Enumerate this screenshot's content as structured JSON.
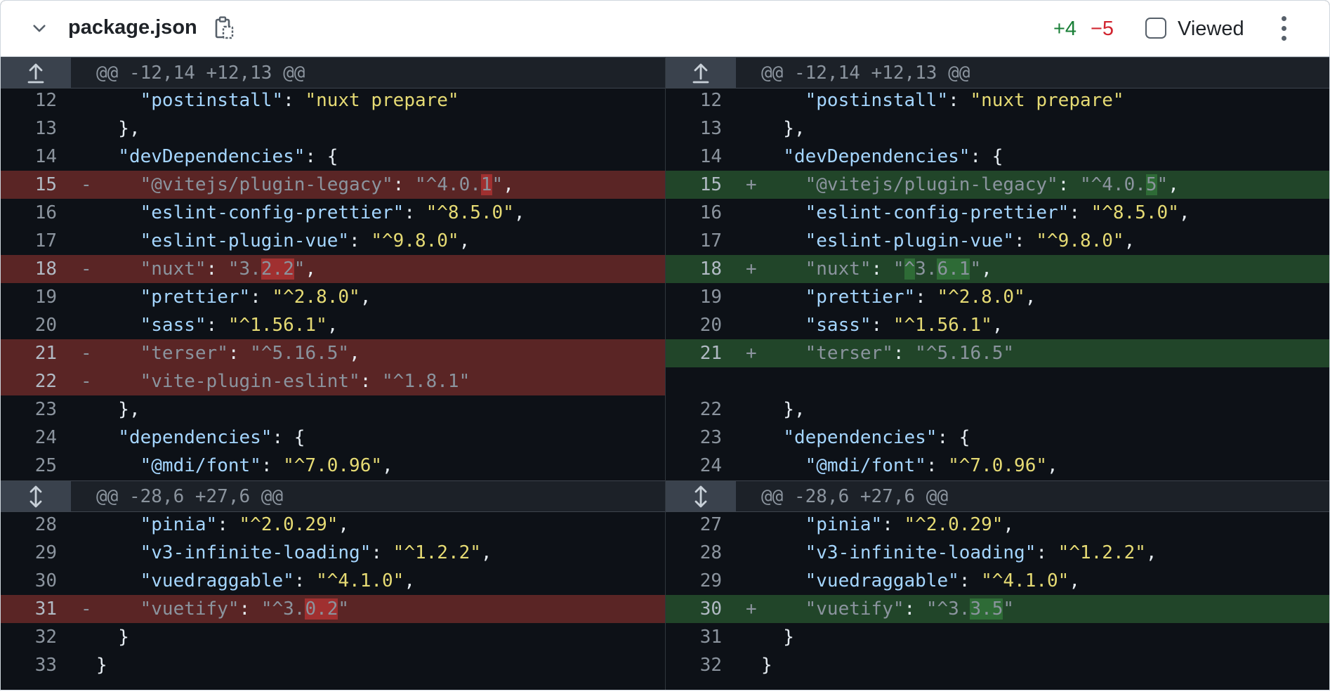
{
  "header": {
    "filename": "package.json",
    "additions": "+4",
    "deletions": "−5",
    "viewed_label": "Viewed",
    "icons": {
      "collapse": "chevron-down-icon",
      "copy": "copy-path-icon",
      "more": "kebab-menu-icon"
    }
  },
  "hunks": [
    {
      "left": "@@ -12,14 +12,13 @@",
      "right": "@@ -12,14 +12,13 @@",
      "icon": "expand-up-icon"
    },
    {
      "left": "@@ -28,6 +27,6 @@",
      "right": "@@ -28,6 +27,6 @@",
      "icon": "expand-both-icon"
    }
  ],
  "left_lines": [
    {
      "n": "12",
      "t": "ctx",
      "a": "    ",
      "k": "\"postinstall\"",
      "b": ": ",
      "v": "\"nuxt prepare\"",
      "c": ""
    },
    {
      "n": "13",
      "t": "ctx",
      "a": "  },",
      "k": "",
      "b": "",
      "v": "",
      "c": ""
    },
    {
      "n": "14",
      "t": "ctx",
      "a": "  ",
      "k": "\"devDependencies\"",
      "b": ": {",
      "v": "",
      "c": ""
    },
    {
      "n": "15",
      "t": "del",
      "a": "    ",
      "k": "\"@vitejs/plugin-legacy\"",
      "b": ": ",
      "v": "\"^4.0.",
      "h": "1",
      "v2": "\"",
      "c": ","
    },
    {
      "n": "16",
      "t": "ctx",
      "a": "    ",
      "k": "\"eslint-config-prettier\"",
      "b": ": ",
      "v": "\"^8.5.0\"",
      "c": ","
    },
    {
      "n": "17",
      "t": "ctx",
      "a": "    ",
      "k": "\"eslint-plugin-vue\"",
      "b": ": ",
      "v": "\"^9.8.0\"",
      "c": ","
    },
    {
      "n": "18",
      "t": "del",
      "a": "    ",
      "k": "\"nuxt\"",
      "b": ": ",
      "v": "\"3.",
      "h": "2.2",
      "v2": "\"",
      "c": ","
    },
    {
      "n": "19",
      "t": "ctx",
      "a": "    ",
      "k": "\"prettier\"",
      "b": ": ",
      "v": "\"^2.8.0\"",
      "c": ","
    },
    {
      "n": "20",
      "t": "ctx",
      "a": "    ",
      "k": "\"sass\"",
      "b": ": ",
      "v": "\"^1.56.1\"",
      "c": ","
    },
    {
      "n": "21",
      "t": "del",
      "a": "    ",
      "k": "\"terser\"",
      "b": ": ",
      "v": "\"^5.16.5\"",
      "c": ","
    },
    {
      "n": "22",
      "t": "del",
      "a": "    ",
      "k": "\"vite-plugin-eslint\"",
      "b": ": ",
      "v": "\"^1.8.1\"",
      "c": ""
    },
    {
      "n": "23",
      "t": "ctx",
      "a": "  },",
      "k": "",
      "b": "",
      "v": "",
      "c": ""
    },
    {
      "n": "24",
      "t": "ctx",
      "a": "  ",
      "k": "\"dependencies\"",
      "b": ": {",
      "v": "",
      "c": ""
    },
    {
      "n": "25",
      "t": "ctx",
      "a": "    ",
      "k": "\"@mdi/font\"",
      "b": ": ",
      "v": "\"^7.0.96\"",
      "c": ","
    },
    {
      "n": "28",
      "t": "ctx",
      "a": "    ",
      "k": "\"pinia\"",
      "b": ": ",
      "v": "\"^2.0.29\"",
      "c": ","
    },
    {
      "n": "29",
      "t": "ctx",
      "a": "    ",
      "k": "\"v3-infinite-loading\"",
      "b": ": ",
      "v": "\"^1.2.2\"",
      "c": ","
    },
    {
      "n": "30",
      "t": "ctx",
      "a": "    ",
      "k": "\"vuedraggable\"",
      "b": ": ",
      "v": "\"^4.1.0\"",
      "c": ","
    },
    {
      "n": "31",
      "t": "del",
      "a": "    ",
      "k": "\"vuetify\"",
      "b": ": ",
      "v": "\"^3.",
      "h": "0.2",
      "v2": "\"",
      "c": ""
    },
    {
      "n": "32",
      "t": "ctx",
      "a": "  }",
      "k": "",
      "b": "",
      "v": "",
      "c": ""
    },
    {
      "n": "33",
      "t": "ctx",
      "a": "}",
      "k": "",
      "b": "",
      "v": "",
      "c": ""
    }
  ],
  "right_lines": [
    {
      "n": "12",
      "t": "ctx",
      "a": "    ",
      "k": "\"postinstall\"",
      "b": ": ",
      "v": "\"nuxt prepare\"",
      "c": ""
    },
    {
      "n": "13",
      "t": "ctx",
      "a": "  },",
      "k": "",
      "b": "",
      "v": "",
      "c": ""
    },
    {
      "n": "14",
      "t": "ctx",
      "a": "  ",
      "k": "\"devDependencies\"",
      "b": ": {",
      "v": "",
      "c": ""
    },
    {
      "n": "15",
      "t": "add",
      "a": "    ",
      "k": "\"@vitejs/plugin-legacy\"",
      "b": ": ",
      "v": "\"^4.0.",
      "h": "5",
      "v2": "\"",
      "c": ","
    },
    {
      "n": "16",
      "t": "ctx",
      "a": "    ",
      "k": "\"eslint-config-prettier\"",
      "b": ": ",
      "v": "\"^8.5.0\"",
      "c": ","
    },
    {
      "n": "17",
      "t": "ctx",
      "a": "    ",
      "k": "\"eslint-plugin-vue\"",
      "b": ": ",
      "v": "\"^9.8.0\"",
      "c": ","
    },
    {
      "n": "18",
      "t": "add",
      "a": "    ",
      "k": "\"nuxt\"",
      "b": ": ",
      "v": "\"",
      "h0": "^",
      "v1": "3.",
      "h": "6.1",
      "v2": "\"",
      "c": ","
    },
    {
      "n": "19",
      "t": "ctx",
      "a": "    ",
      "k": "\"prettier\"",
      "b": ": ",
      "v": "\"^2.8.0\"",
      "c": ","
    },
    {
      "n": "20",
      "t": "ctx",
      "a": "    ",
      "k": "\"sass\"",
      "b": ": ",
      "v": "\"^1.56.1\"",
      "c": ","
    },
    {
      "n": "21",
      "t": "add",
      "a": "    ",
      "k": "\"terser\"",
      "b": ": ",
      "v": "\"^5.16.5\"",
      "c": ""
    },
    {
      "n": "",
      "t": "empty",
      "a": "",
      "k": "",
      "b": "",
      "v": "",
      "c": ""
    },
    {
      "n": "22",
      "t": "ctx",
      "a": "  },",
      "k": "",
      "b": "",
      "v": "",
      "c": ""
    },
    {
      "n": "23",
      "t": "ctx",
      "a": "  ",
      "k": "\"dependencies\"",
      "b": ": {",
      "v": "",
      "c": ""
    },
    {
      "n": "24",
      "t": "ctx",
      "a": "    ",
      "k": "\"@mdi/font\"",
      "b": ": ",
      "v": "\"^7.0.96\"",
      "c": ","
    },
    {
      "n": "27",
      "t": "ctx",
      "a": "    ",
      "k": "\"pinia\"",
      "b": ": ",
      "v": "\"^2.0.29\"",
      "c": ","
    },
    {
      "n": "28",
      "t": "ctx",
      "a": "    ",
      "k": "\"v3-infinite-loading\"",
      "b": ": ",
      "v": "\"^1.2.2\"",
      "c": ","
    },
    {
      "n": "29",
      "t": "ctx",
      "a": "    ",
      "k": "\"vuedraggable\"",
      "b": ": ",
      "v": "\"^4.1.0\"",
      "c": ","
    },
    {
      "n": "30",
      "t": "add",
      "a": "    ",
      "k": "\"vuetify\"",
      "b": ": ",
      "v": "\"^3.",
      "h": "3.5",
      "v2": "\"",
      "c": ""
    },
    {
      "n": "31",
      "t": "ctx",
      "a": "  }",
      "k": "",
      "b": "",
      "v": "",
      "c": ""
    },
    {
      "n": "32",
      "t": "ctx",
      "a": "}",
      "k": "",
      "b": "",
      "v": "",
      "c": ""
    }
  ],
  "colors": {
    "added": "#1a7f37",
    "deleted": "#d1242f",
    "del_row": "#5a2525",
    "add_row": "#214529",
    "bg": "#0d1117"
  }
}
